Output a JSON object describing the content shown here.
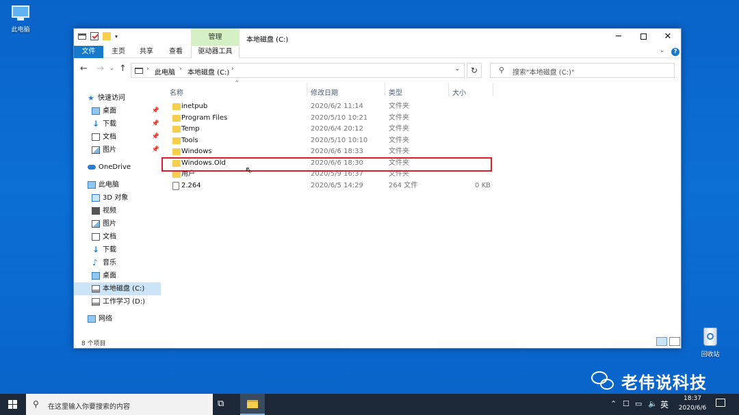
{
  "desktop": {
    "this_pc_label": "此电脑",
    "recycle_label": "回收站"
  },
  "window": {
    "title": "本地磁盘 (C:)",
    "manage_tab": "管理",
    "ribbon_tabs": [
      "文件",
      "主页",
      "共享",
      "查看",
      "驱动器工具"
    ],
    "address": [
      "此电脑",
      "本地磁盘 (C:)"
    ],
    "search_placeholder": "搜索\"本地磁盘 (C:)\"",
    "help": "?"
  },
  "nav_pane": {
    "quick_access": "快速访问",
    "quick_items": [
      "桌面",
      "下载",
      "文档",
      "图片"
    ],
    "onedrive": "OneDrive",
    "this_pc": "此电脑",
    "pc_items": [
      "3D 对象",
      "视频",
      "图片",
      "文档",
      "下载",
      "音乐",
      "桌面",
      "本地磁盘 (C:)",
      "工作学习 (D:)"
    ],
    "network": "网络"
  },
  "columns": {
    "name": "名称",
    "date": "修改日期",
    "type": "类型",
    "size": "大小"
  },
  "files": [
    {
      "name": "inetpub",
      "date": "2020/6/2 11:14",
      "type": "文件夹",
      "size": ""
    },
    {
      "name": "Program Files",
      "date": "2020/5/10 10:21",
      "type": "文件夹",
      "size": ""
    },
    {
      "name": "Temp",
      "date": "2020/6/4 20:12",
      "type": "文件夹",
      "size": ""
    },
    {
      "name": "Tools",
      "date": "2020/5/10 10:10",
      "type": "文件夹",
      "size": ""
    },
    {
      "name": "Windows",
      "date": "2020/6/6 18:33",
      "type": "文件夹",
      "size": ""
    },
    {
      "name": "Windows.Old",
      "date": "2020/6/6 18:30",
      "type": "文件夹",
      "size": ""
    },
    {
      "name": "用户",
      "date": "2020/5/9 16:37",
      "type": "文件夹",
      "size": ""
    },
    {
      "name": "2.264",
      "date": "2020/6/5 14:29",
      "type": "264 文件",
      "size": "0 KB"
    }
  ],
  "status": {
    "count": "8 个项目"
  },
  "watermark": {
    "text": "老伟说科技"
  },
  "taskbar": {
    "search_text": "在这里输入你要搜索的内容",
    "ime": "英",
    "time": "18:37",
    "date": "2020/6/6"
  },
  "colors": {
    "highlight_border": "#d91e2a",
    "file_tab": "#1979ca",
    "manage_tab": "#d4f0c4",
    "desktop": "#0a63c9"
  }
}
